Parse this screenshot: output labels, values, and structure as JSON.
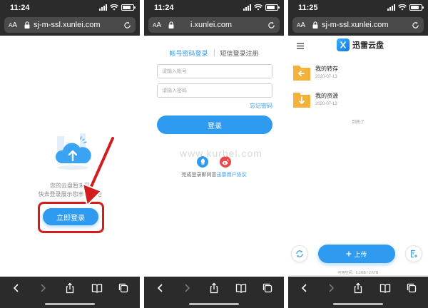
{
  "colors": {
    "accent": "#2f9bf0",
    "highlight": "#d11d1d",
    "folder": "#f4b23a",
    "chrome": "#2b2b2b"
  },
  "phones": [
    {
      "status_time": "11:24",
      "url": "sj-m-ssl.xunlei.com",
      "message_line1": "您的云盘暂未开",
      "message_line2": "快去登录展示您丰富",
      "message_tail": "吧",
      "login_button": "立即登录"
    },
    {
      "status_time": "11:24",
      "url": "i.xunlei.com",
      "tab_password": "帐号密码登录",
      "tab_sms": "短信登录注册",
      "account_placeholder": "请输入帐号",
      "password_placeholder": "请输入密码",
      "forgot_password": "忘记密码",
      "login_button": "登录",
      "agree_text": "完成登录即同意",
      "agree_link": "迅雷用户协议"
    },
    {
      "status_time": "11:25",
      "url": "sj-m-ssl.xunlei.com",
      "app_name": "迅雷云盘",
      "folders": [
        {
          "name": "我的转存",
          "date": "2020-07-13"
        },
        {
          "name": "我的资源",
          "date": "2020-07-13"
        }
      ],
      "end_text": "到底了",
      "upload_button": "上传",
      "storage_text": "可用空间：6.1GB / 2.6TB"
    }
  ],
  "url_aa": {
    "small": "A",
    "big": "A"
  },
  "watermark": "www.kurbel.com"
}
